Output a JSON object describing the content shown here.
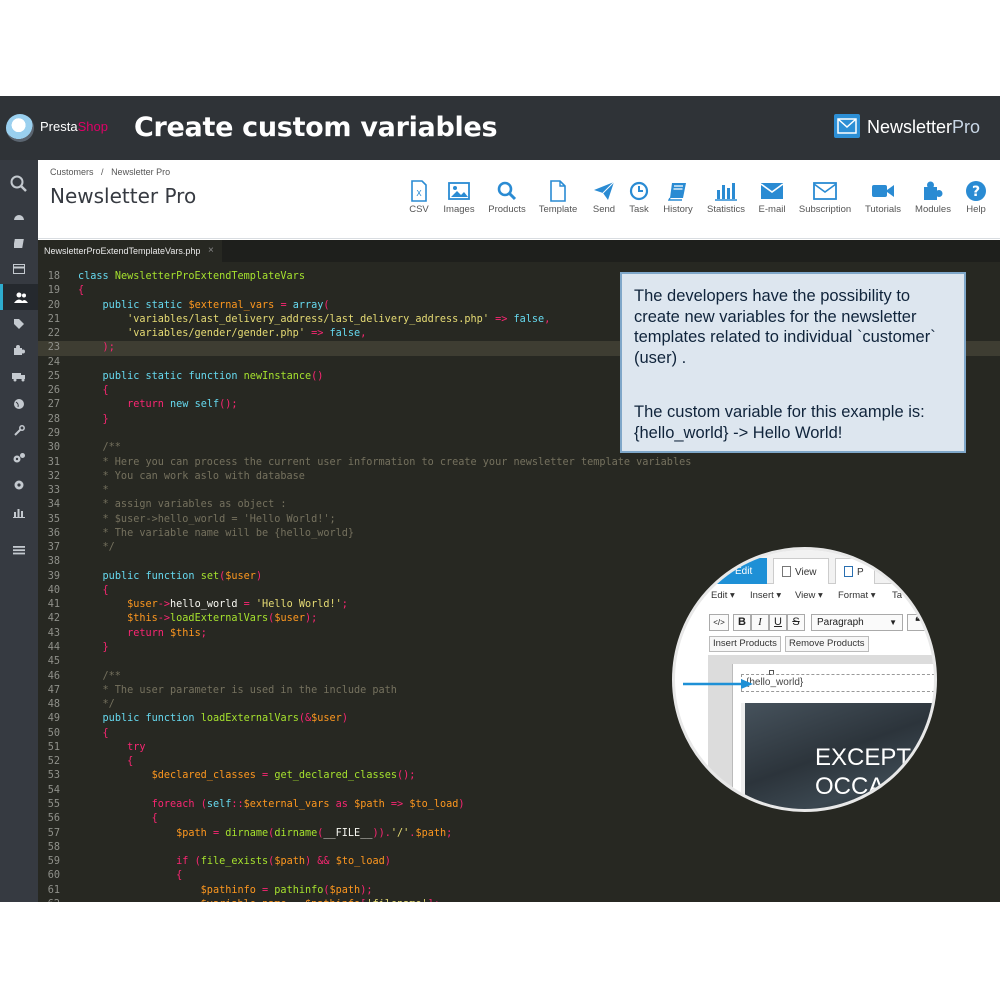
{
  "banner": {
    "ps_brand_1": "Presta",
    "ps_brand_2": "Shop",
    "title": "Create custom variables",
    "np_brand_1": "Newsletter",
    "np_brand_2": "Pro"
  },
  "header": {
    "breadcrumb_1": "Customers",
    "breadcrumb_sep": "/",
    "breadcrumb_2": "Newsletter Pro",
    "title": "Newsletter Pro",
    "toolbar": [
      {
        "label": "CSV",
        "icon": "csv-file-icon"
      },
      {
        "label": "Images",
        "icon": "image-icon"
      },
      {
        "label": "Products",
        "icon": "search-icon"
      },
      {
        "label": "Template",
        "icon": "file-icon"
      },
      {
        "label": "Send",
        "icon": "paper-plane-icon"
      },
      {
        "label": "Task",
        "icon": "clock-icon"
      },
      {
        "label": "History",
        "icon": "book-icon"
      },
      {
        "label": "Statistics",
        "icon": "bar-chart-icon"
      },
      {
        "label": "E-mail",
        "icon": "envelope-icon"
      },
      {
        "label": "Subscription",
        "icon": "envelope-outline-icon"
      },
      {
        "label": "Tutorials",
        "icon": "video-camera-icon"
      },
      {
        "label": "Modules",
        "icon": "puzzle-icon"
      },
      {
        "label": "Help",
        "icon": "question-icon"
      }
    ]
  },
  "sidebar": {
    "icons": [
      "search-icon",
      "dashboard-icon",
      "orders-icon",
      "payment-icon",
      "customers-icon",
      "catalog-tag-icon",
      "modules-puzzle-icon",
      "shipping-truck-icon",
      "localization-globe-icon",
      "wrench-icon",
      "advanced-gears-icon",
      "settings-gear-icon",
      "stats-icon",
      "menu-icon"
    ]
  },
  "editor": {
    "tab_name": "NewsletterProExtendTemplateVars.php",
    "tab_close": "×",
    "highlight_line": "23",
    "lines": [
      {
        "n": "18",
        "t": "class NewsletterProExtendTemplateVars"
      },
      {
        "n": "19",
        "t": "{"
      },
      {
        "n": "20",
        "t": "    public static $external_vars = array("
      },
      {
        "n": "21",
        "t": "        'variables/last_delivery_address/last_delivery_address.php' => false,"
      },
      {
        "n": "22",
        "t": "        'variables/gender/gender.php' => false,"
      },
      {
        "n": "23",
        "t": "    );"
      },
      {
        "n": "24",
        "t": ""
      },
      {
        "n": "25",
        "t": "    public static function newInstance()"
      },
      {
        "n": "26",
        "t": "    {"
      },
      {
        "n": "27",
        "t": "        return new self();"
      },
      {
        "n": "28",
        "t": "    }"
      },
      {
        "n": "29",
        "t": ""
      },
      {
        "n": "30",
        "t": "    /**"
      },
      {
        "n": "31",
        "t": "    * Here you can process the current user information to create your newsletter template variables"
      },
      {
        "n": "32",
        "t": "    * You can work aslo with database"
      },
      {
        "n": "33",
        "t": "    *"
      },
      {
        "n": "34",
        "t": "    * assign variables as object :"
      },
      {
        "n": "35",
        "t": "    * $user->hello_world = 'Hello World!';"
      },
      {
        "n": "36",
        "t": "    * The variable name will be {hello_world}"
      },
      {
        "n": "37",
        "t": "    */"
      },
      {
        "n": "38",
        "t": ""
      },
      {
        "n": "39",
        "t": "    public function set($user)"
      },
      {
        "n": "40",
        "t": "    {"
      },
      {
        "n": "41",
        "t": "        $user->hello_world = 'Hello World!';"
      },
      {
        "n": "42",
        "t": "        $this->loadExternalVars($user);"
      },
      {
        "n": "43",
        "t": "        return $this;"
      },
      {
        "n": "44",
        "t": "    }"
      },
      {
        "n": "45",
        "t": ""
      },
      {
        "n": "46",
        "t": "    /**"
      },
      {
        "n": "47",
        "t": "    * The user parameter is used in the include path"
      },
      {
        "n": "48",
        "t": "    */"
      },
      {
        "n": "49",
        "t": "    public function loadExternalVars(&$user)"
      },
      {
        "n": "50",
        "t": "    {"
      },
      {
        "n": "51",
        "t": "        try"
      },
      {
        "n": "52",
        "t": "        {"
      },
      {
        "n": "53",
        "t": "            $declared_classes = get_declared_classes();"
      },
      {
        "n": "54",
        "t": ""
      },
      {
        "n": "55",
        "t": "            foreach (self::$external_vars as $path => $to_load)"
      },
      {
        "n": "56",
        "t": "            {"
      },
      {
        "n": "57",
        "t": "                $path = dirname(dirname(__FILE__)).'/'.$path;"
      },
      {
        "n": "58",
        "t": ""
      },
      {
        "n": "59",
        "t": "                if (file_exists($path) && $to_load)"
      },
      {
        "n": "60",
        "t": "                {"
      },
      {
        "n": "61",
        "t": "                    $pathinfo = pathinfo($path);"
      },
      {
        "n": "62",
        "t": "                    $variable_name = $pathinfo['filename'];"
      }
    ]
  },
  "callout": {
    "paragraph_1": "The developers have the possibility to create new variables for the newsletter templates related to individual `customer` (user) .",
    "paragraph_2": "The custom variable for this example is: {hello_world} -> Hello World!"
  },
  "zoom": {
    "tab_edit": "Edit",
    "tab_view": "View",
    "tab_partial": "P",
    "menu": [
      "Edit ▾",
      "Insert ▾",
      "View ▾",
      "Format ▾",
      "Ta"
    ],
    "fmt_buttons": [
      "</>",
      "B",
      "I",
      "U",
      "S"
    ],
    "paragraph_select": "Paragraph",
    "quote_btn": "❝",
    "insert_products": "Insert Products",
    "remove_products": "Remove Products",
    "variable": "{hello_world}",
    "image_text_1": "EXCEPT",
    "image_text_2": "OCCA"
  },
  "colors": {
    "banner_bg": "#2f3337",
    "sidebar_bg": "#363a41",
    "editor_bg": "#272822",
    "accent_blue": "#2d8fd5",
    "callout_bg": "#dde6ef",
    "callout_border": "#7fa7c9"
  }
}
